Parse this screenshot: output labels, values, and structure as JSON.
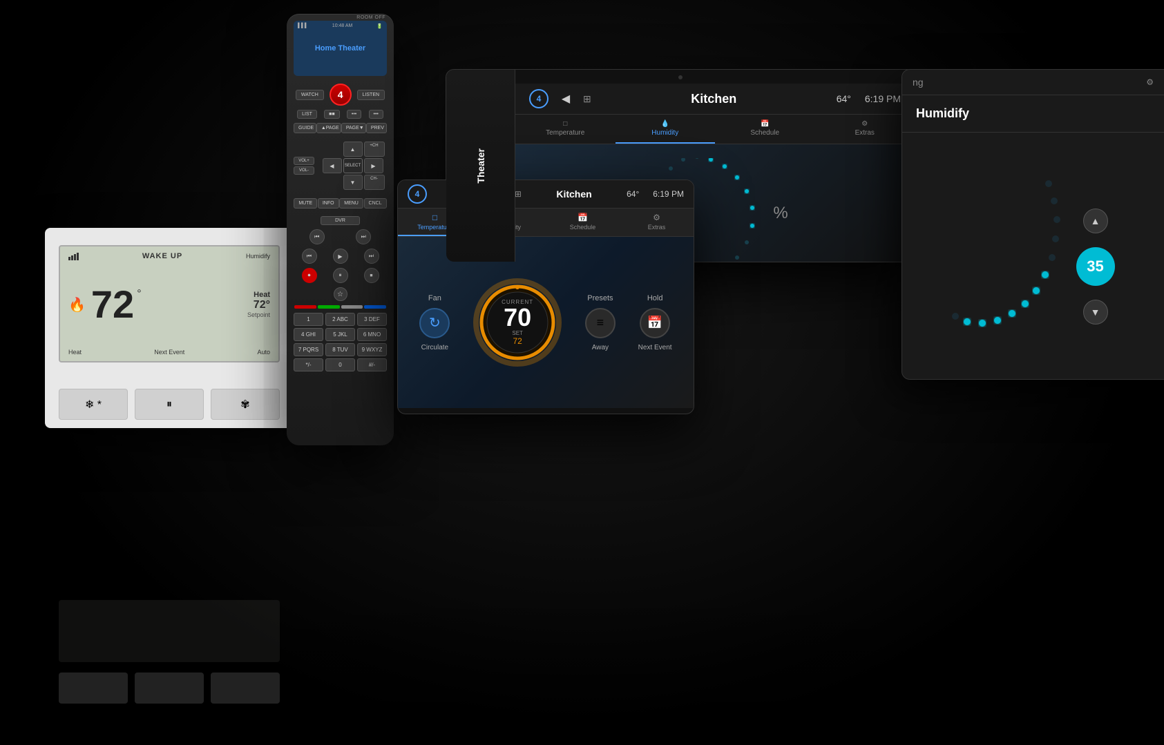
{
  "scene": {
    "background": "#000000"
  },
  "thermostat": {
    "title": "WAKE UP",
    "humidity_label": "Humidify",
    "current_temp": "72",
    "degree_symbol": "°",
    "heat_label": "Heat",
    "setpoint_temp": "72°",
    "setpoint_label": "Setpoint",
    "next_event_label": "Next Event",
    "auto_label": "Auto",
    "buttons": {
      "snowflake": "❄*",
      "pause": "⏸",
      "fan": "❋"
    }
  },
  "remote": {
    "room_off_label": "ROOM OFF",
    "time": "10:48 AM",
    "title": "Home Theater",
    "watch_label": "WATCH",
    "listen_label": "LISTEN",
    "list_label": "LIST",
    "guide_label": "GUIDE",
    "apage_label": "▲PAGE",
    "pagev_label": "PAGE▼",
    "prev_label": "PREV",
    "vol_label": "VOL",
    "select_label": "SELECT",
    "ch_label": "+ CH",
    "vol_down_label": "VOL",
    "ch_down_label": "CH-",
    "mute_label": "MUTE",
    "info_label": "INFO",
    "menu_label": "MENU",
    "cncl_label": "CNCL",
    "dvr_label": "DVR",
    "num1": "1",
    "num2": "2 ABC",
    "num3": "3 DEF",
    "num4": "4 GHI",
    "num5": "5 JKL",
    "num6": "6 MNO",
    "num7": "7 PQRS",
    "num8": "8 TUV",
    "num9": "9 WXYZ",
    "star": "*/-",
    "num0": "0",
    "hash": "#/-"
  },
  "tablet_large": {
    "header": {
      "location": "Kitchen",
      "temp": "64°",
      "time": "6:19 PM"
    },
    "tabs": [
      {
        "label": "Temperature",
        "icon": "□",
        "active": true
      },
      {
        "label": "Humidity",
        "icon": "💧",
        "active": false
      },
      {
        "label": "Schedule",
        "icon": "📅",
        "active": false
      },
      {
        "label": "Extras",
        "icon": "⚙",
        "active": false
      }
    ],
    "fan_label": "Fan",
    "circulate_label": "Circulate",
    "gauge_current_label": "CURRENT",
    "gauge_value": "70",
    "gauge_set_label": "SET",
    "gauge_set_value": "72",
    "presets_label": "Presets",
    "away_label": "Away",
    "hold_label": "Hold",
    "next_event_label": "Next Event"
  },
  "tablet_main": {
    "theater_label": "Theater",
    "header": {
      "location": "Kitchen",
      "temp": "64°",
      "time": "6:19 PM"
    },
    "tabs": [
      {
        "label": "Temperature",
        "icon": "□",
        "active": false
      },
      {
        "label": "Humidity",
        "icon": "💧",
        "active": true
      },
      {
        "label": "Schedule",
        "icon": "📅",
        "active": false
      },
      {
        "label": "Extras",
        "icon": "⚙",
        "active": false
      }
    ]
  },
  "humidify_panel": {
    "title": "Humidify",
    "value": "35",
    "percent_symbol": "%",
    "ng_label": "ng"
  },
  "colors": {
    "accent_blue": "#4a9eff",
    "accent_cyan": "#00bcd4",
    "gauge_gold": "#e88c00",
    "active_tab": "#4a9eff"
  }
}
